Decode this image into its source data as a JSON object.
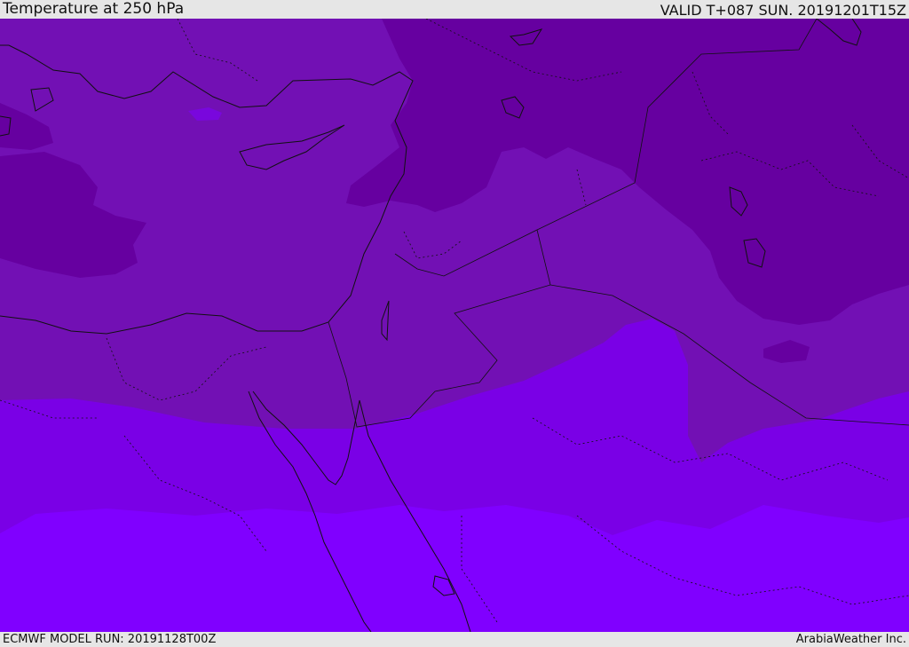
{
  "header": {
    "title": "Temperature at 250 hPa",
    "valid": "VALID T+087 SUN. 20191201T15Z"
  },
  "footer": {
    "model_run": "ECMWF MODEL RUN: 20191128T00Z",
    "credit": "ArabiaWeather Inc."
  },
  "map": {
    "fill_colors": {
      "coldest": "#6600a0",
      "cold": "#7210b4",
      "mid": "#7a00e6",
      "warm": "#8000ff"
    },
    "line_color": "#111111"
  }
}
